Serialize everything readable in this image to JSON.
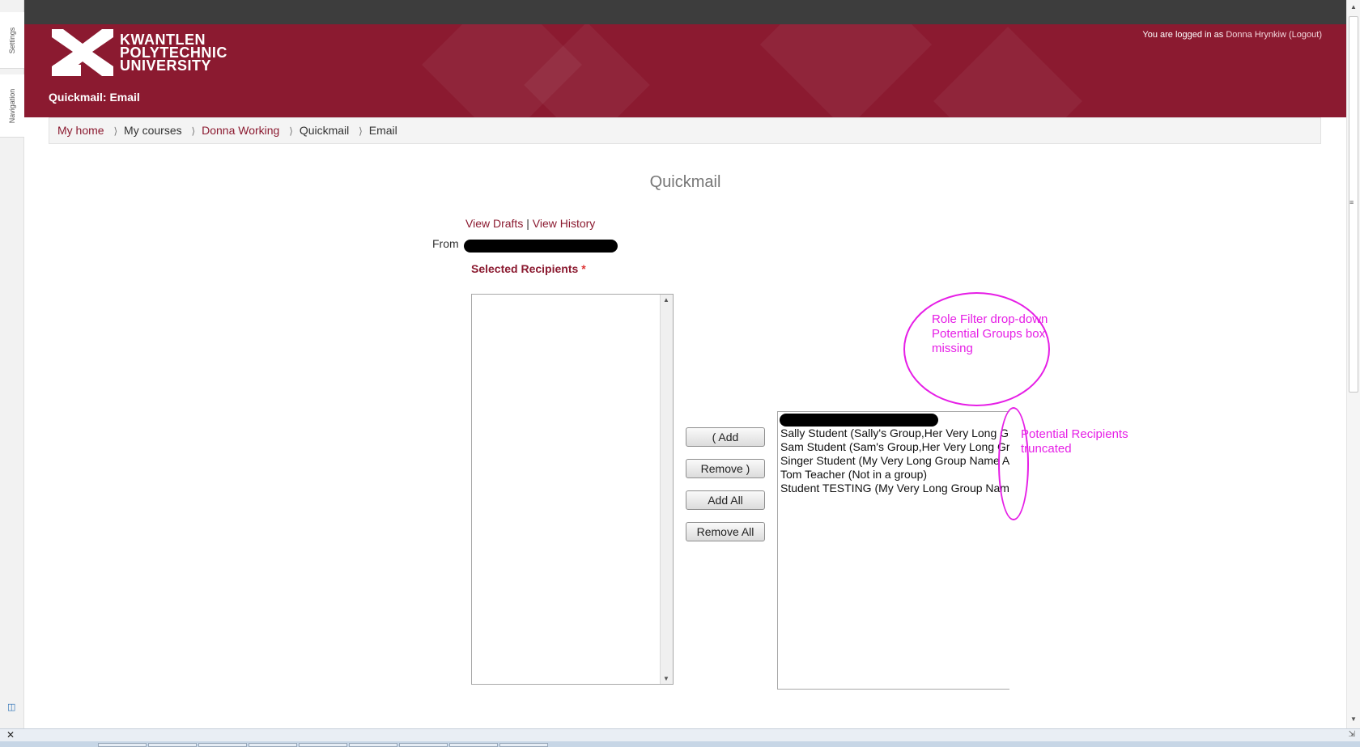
{
  "dock": {
    "settings_label": "Settings",
    "navigation_label": "Navigation",
    "toggle_glyph": "◫"
  },
  "header": {
    "logo_lines": [
      "KWANTLEN",
      "POLYTECHNIC",
      "UNIVERSITY"
    ],
    "page_heading": "Quickmail: Email",
    "login_prefix": "You are logged in as",
    "user_name": "Donna Hrynkiw",
    "logout_label": "(Logout)"
  },
  "breadcrumb": {
    "items": [
      "My home",
      "My courses",
      "Donna Working",
      "Quickmail",
      "Email"
    ],
    "separator": "⟩"
  },
  "page_title": "Quickmail",
  "links": {
    "view_drafts": "View Drafts",
    "divider": "|",
    "view_history": "View History"
  },
  "form": {
    "from_label": "From",
    "selected_recipients_label": "Selected Recipients",
    "required_marker": "*"
  },
  "buttons": {
    "add": "( Add",
    "remove": "Remove )",
    "add_all": "Add All",
    "remove_all": "Remove All"
  },
  "potential_recipients": [
    "Sally Student (Sally's Group,Her Very Long Gr",
    "Sam Student (Sam's Group,Her Very Long Gro",
    "Singer Student (My Very Long Group Name A",
    "Tom Teacher (Not in a group)",
    "Student TESTING (My Very Long Group Nam"
  ],
  "annotations": {
    "missing_line1": "Role Filter drop-down",
    "missing_line2": "Potential Groups box",
    "missing_line3": "missing",
    "truncated_line1": "Potential Recipients",
    "truncated_line2": "truncated"
  },
  "statusbar": {
    "close_glyph": "✕",
    "resize_glyph": "⇲"
  },
  "colors": {
    "brand": "#8b1a30",
    "annotation": "#e61ee6",
    "topbar": "#3d3d3d"
  }
}
